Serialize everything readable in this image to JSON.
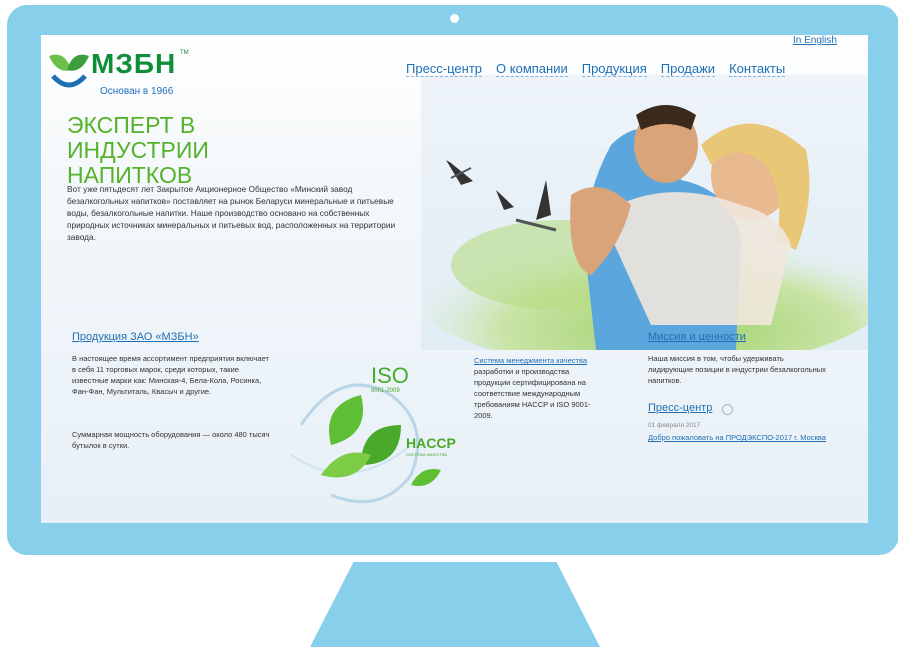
{
  "logo": {
    "name": "МЗБН",
    "tm": "TM",
    "subtitle": "Основан в 1966"
  },
  "lang_link": "In English",
  "nav": {
    "items": [
      {
        "label": "Пресс-центр"
      },
      {
        "label": "О компании"
      },
      {
        "label": "Продукция"
      },
      {
        "label": "Продажи"
      },
      {
        "label": "Контакты"
      }
    ]
  },
  "hero": {
    "title": "ЭКСПЕРТ В ИНДУСТРИИ НАПИТКОВ",
    "text": "Вот уже пятьдесят лет Закрытое Акционерное Общество «Минский завод безалкогольных напитков» поставляет на рынок Беларуси минеральные и питьевые воды, безалкогольные напитки. Наше производство основано на собственных природных источниках минеральных и питьевых вод, расположенных на территории завода."
  },
  "products": {
    "title": "Продукция ЗАО «МЗБН»",
    "text": "В настоящее время ассортимент предприятия включает в себя 11 торговых марок, среди которых, такие известные марки как: Минская-4, Бела-Кола, Росинка, Фан-Фан, Мультиталь, Квасыч и другие.",
    "capacity": "Суммарная мощность оборудования — около 480 тысяч бутылок в сутки."
  },
  "certificates": {
    "iso_label": "ISO",
    "iso_sub": "9001-2009",
    "haccp_label": "HACCP",
    "haccp_sub": "СИСТЕМА КАЧЕСТВА",
    "link": "Система менеджмента качества",
    "text": " разработки и производства продукции сертифицирована на соответствие международным требованиям HACCP и ISO 9001-2009."
  },
  "mission": {
    "title": "Миссия и ценности",
    "text": "Наша миссия в том, чтобы удерживать лидирующие позиции в индустрии безалкогольных напитков."
  },
  "press": {
    "title": "Пресс-центр",
    "date": "01 февраля 2017",
    "link": "Добро пожаловать на ПРОДЭКСПО-2017 г. Москва"
  },
  "colors": {
    "frame": "#87cfea",
    "accent_green": "#55b22b",
    "link_blue": "#1f6fb5"
  }
}
